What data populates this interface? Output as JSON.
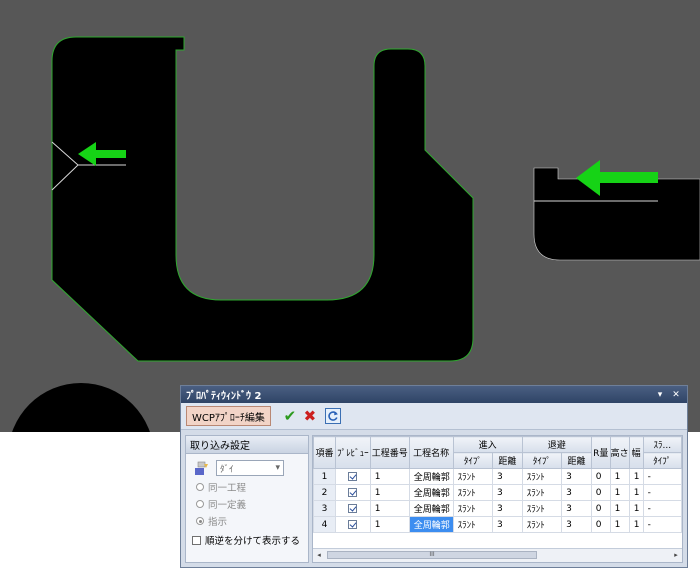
{
  "window": {
    "title": "ﾌﾟﾛﾊﾟﾃｨｳｨﾝﾄﾞｳ 2",
    "menu_glyph": "▾",
    "close_glyph": "✕"
  },
  "toolbar": {
    "wcp_button_label": "WCPｱﾌﾟﾛｰﾁ編集",
    "check_glyph": "✔",
    "x_glyph": "✖"
  },
  "left_panel": {
    "header": "取り込み設定",
    "die_select_value": "ﾀﾞｲ",
    "radio_options": [
      "同一工程",
      "同一定義",
      "指示"
    ],
    "selected_radio_index": 2,
    "reverse_label": "順逆を分けて表示する"
  },
  "grid": {
    "headers": {
      "index": "項番",
      "preview": "ﾌﾟﾚﾋﾞｭｰ",
      "process_no": "工程番号",
      "process_name": "工程名称",
      "approach": "進入",
      "retreat": "退避",
      "r_amount": "R量",
      "height": "高さ",
      "width": "幅",
      "slant": "ｽﾗ...",
      "type": "ﾀｲﾌﾟ",
      "distance": "距離"
    },
    "rows": [
      {
        "index": "1",
        "process_no": "1",
        "process_name": "全周輪郭",
        "approach_type": "ｽﾗﾝﾄ",
        "approach_dist": "3",
        "retreat_type": "ｽﾗﾝﾄ",
        "retreat_dist": "3",
        "r": "0",
        "h": "1",
        "w": "1",
        "slant": "-"
      },
      {
        "index": "2",
        "process_no": "1",
        "process_name": "全周輪郭",
        "approach_type": "ｽﾗﾝﾄ",
        "approach_dist": "3",
        "retreat_type": "ｽﾗﾝﾄ",
        "retreat_dist": "3",
        "r": "0",
        "h": "1",
        "w": "1",
        "slant": "-"
      },
      {
        "index": "3",
        "process_no": "1",
        "process_name": "全周輪郭",
        "approach_type": "ｽﾗﾝﾄ",
        "approach_dist": "3",
        "retreat_type": "ｽﾗﾝﾄ",
        "retreat_dist": "3",
        "r": "0",
        "h": "1",
        "w": "1",
        "slant": "-"
      },
      {
        "index": "4",
        "process_no": "1",
        "process_name": "全周輪郭",
        "approach_type": "ｽﾗﾝﾄ",
        "approach_dist": "3",
        "retreat_type": "ｽﾗﾝﾄ",
        "retreat_dist": "3",
        "r": "0",
        "h": "1",
        "w": "1",
        "slant": "-"
      }
    ],
    "scroll_thumb_text": "III"
  },
  "colors": {
    "viewport_bg": "#575757",
    "shape_fill": "#000000",
    "contour": "#2ea82e",
    "arrow": "#16d316",
    "selection": "#3c8df0"
  }
}
